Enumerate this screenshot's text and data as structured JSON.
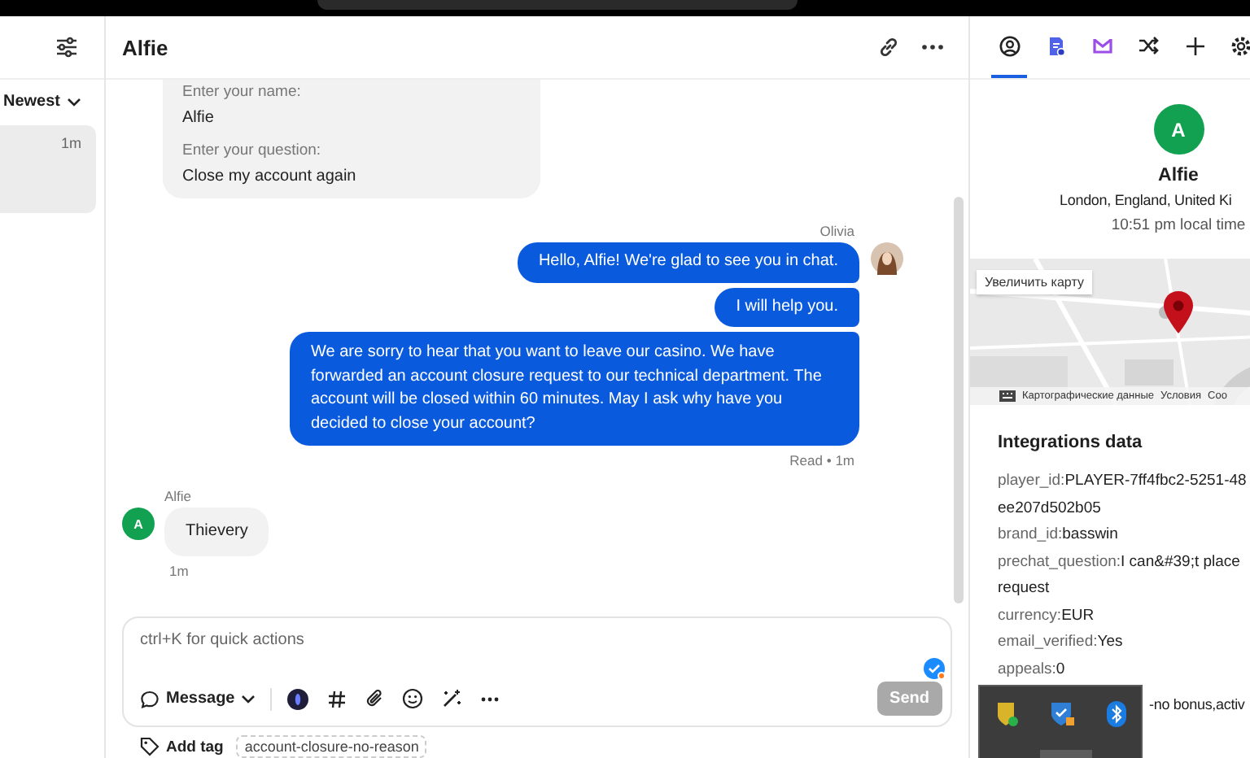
{
  "sidebar": {
    "sort": "Newest",
    "items": [
      {
        "time": "1m",
        "selected": true
      }
    ]
  },
  "chat": {
    "title": "Alfie",
    "messages": [
      {
        "kind": "form",
        "fields": [
          {
            "label": "Enter your name:",
            "value": "Alfie"
          },
          {
            "label": "Enter your question:",
            "value": "Close my account again"
          }
        ]
      },
      {
        "kind": "agent",
        "author": "Olivia",
        "bubbles": [
          "Hello, Alfie! We're glad to see you in chat.",
          "I will help you.",
          "We are sorry to hear that you want to leave our casino. We have forwarded an account closure request to our technical department. The account will be closed within 60 minutes. May I ask why have you decided to close your account?"
        ],
        "status": "Read • 1m"
      },
      {
        "kind": "customer",
        "author": "Alfie",
        "initial": "A",
        "bubbles": [
          "Thievery"
        ],
        "status": "1m"
      }
    ]
  },
  "composer": {
    "placeholder": "ctrl+K for quick actions",
    "mode": "Message",
    "send": "Send",
    "send_disabled": true
  },
  "tags": {
    "add": "Add tag",
    "items": [
      "account-closure-no-reason"
    ]
  },
  "panel": {
    "tabs": [
      {
        "kind": "person",
        "selected": true
      },
      {
        "kind": "doc",
        "selected": false
      },
      {
        "kind": "inbox",
        "selected": false
      },
      {
        "kind": "shuffle",
        "selected": false
      },
      {
        "kind": "plus",
        "selected": false
      },
      {
        "kind": "gear",
        "selected": false
      }
    ],
    "profile": {
      "initial": "A",
      "name": "Alfie",
      "location": "London, England, United Ki",
      "local_time": "10:51 pm local time"
    },
    "map": {
      "zoom_button": "Увеличить карту",
      "footer": [
        "Картографические данные",
        "Условия",
        "Coo"
      ]
    },
    "integrations": {
      "title": "Integrations data",
      "rows": [
        {
          "key": "player_id:",
          "lines": [
            "PLAYER-7ff4fbc2-5251-48",
            "ee207d502b05"
          ]
        },
        {
          "key": "brand_id:",
          "lines": [
            "basswin"
          ]
        },
        {
          "key": "prechat_question:",
          "lines": [
            "I can&#39;t place",
            "request"
          ]
        },
        {
          "key": "currency:",
          "lines": [
            "EUR"
          ]
        },
        {
          "key": "email_verified:",
          "lines": [
            "Yes"
          ]
        },
        {
          "key": "appeals:",
          "lines": [
            "0"
          ]
        }
      ],
      "more": "-no bonus,activ"
    }
  }
}
